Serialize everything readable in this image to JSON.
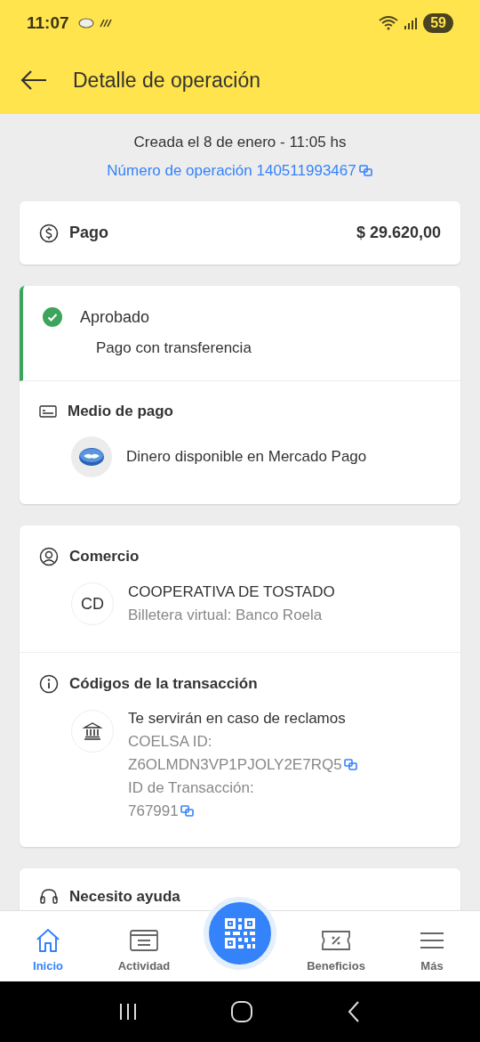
{
  "status_bar": {
    "time": "11:07",
    "battery": "59"
  },
  "header": {
    "title": "Detalle de operación"
  },
  "summary": {
    "created": "Creada el 8 de enero - 11:05 hs",
    "operation_link": "Número de operación 140511993467"
  },
  "payment": {
    "label": "Pago",
    "amount": "$ 29.620,00"
  },
  "status_card": {
    "status": "Aprobado",
    "approved": true,
    "description": "Pago con transferencia",
    "method_title": "Medio de pago",
    "method": "Dinero disponible en Mercado Pago"
  },
  "merchant_card": {
    "title": "Comercio",
    "initials": "CD",
    "name": "COOPERATIVA DE TOSTADO",
    "subtitle": "Billetera virtual: Banco Roela",
    "codes_title": "Códigos de la transacción",
    "codes_note": "Te servirán en caso de reclamos",
    "codes": [
      {
        "label": "COELSA ID:",
        "value": "Z6OLMDN3VP1PJOLY2E7RQ5"
      },
      {
        "label": "ID de Transacción:",
        "value": "767991"
      }
    ]
  },
  "help_card": {
    "title": "Necesito ayuda"
  },
  "bottom_nav": [
    {
      "kind": "home",
      "label": "Inicio",
      "selected": true
    },
    {
      "kind": "activity",
      "label": "Actividad",
      "selected": false
    },
    {
      "kind": "qr",
      "selected": false
    },
    {
      "kind": "benefits",
      "label": "Beneficios",
      "selected": false
    },
    {
      "kind": "more",
      "label": "Más",
      "selected": false
    }
  ]
}
